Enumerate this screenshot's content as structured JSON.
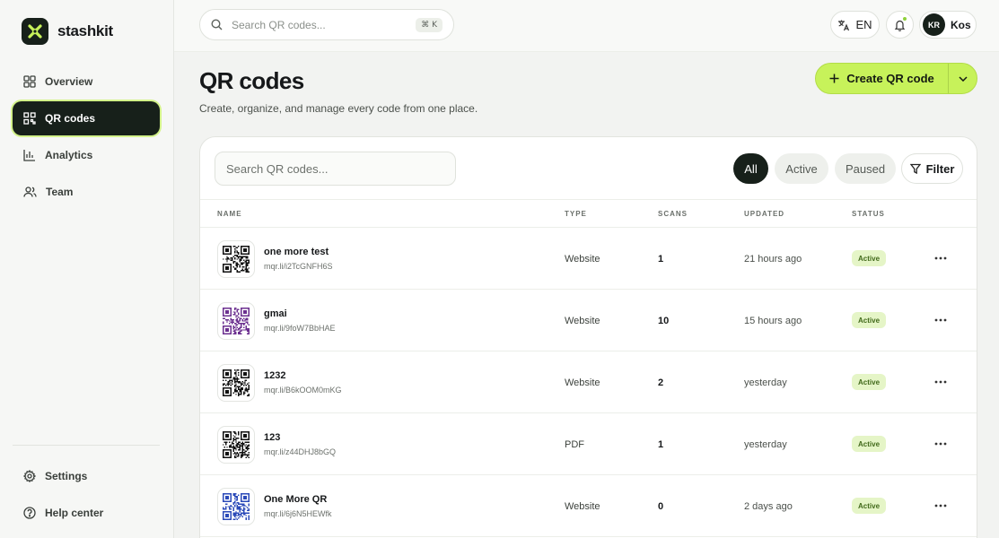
{
  "brand": {
    "name": "stashkit",
    "accent": "#c7f25a"
  },
  "sidebar": {
    "items": [
      {
        "label": "Overview",
        "icon": "grid-icon"
      },
      {
        "label": "QR codes",
        "icon": "qr-icon",
        "active": true
      },
      {
        "label": "Analytics",
        "icon": "bar-chart-icon"
      },
      {
        "label": "Team",
        "icon": "users-icon"
      }
    ],
    "bottom": [
      {
        "label": "Settings",
        "icon": "gear-icon"
      },
      {
        "label": "Help center",
        "icon": "help-icon"
      }
    ]
  },
  "topbar": {
    "search_placeholder": "Search QR codes...",
    "shortcut": "⌘ K",
    "language": "EN",
    "user_initials": "KR",
    "user_name": "Kos"
  },
  "header": {
    "title": "QR codes",
    "subtitle": "Create, organize, and manage every code from one place.",
    "create_label": "Create QR code"
  },
  "table": {
    "search_placeholder": "Search QR codes...",
    "filters": [
      "All",
      "Active",
      "Paused"
    ],
    "filter_button": "Filter",
    "columns": [
      "NAME",
      "TYPE",
      "SCANS",
      "UPDATED",
      "STATUS"
    ],
    "rows": [
      {
        "name": "one more test",
        "url": "mqr.li/i2TcGNFH6S",
        "type": "Website",
        "scans": "1",
        "updated": "21 hours ago",
        "status": "Active",
        "qr_color": "#111111"
      },
      {
        "name": "gmai",
        "url": "mqr.li/9foW7BbHAE",
        "type": "Website",
        "scans": "10",
        "updated": "15 hours ago",
        "status": "Active",
        "qr_color": "#6b2f8f"
      },
      {
        "name": "1232",
        "url": "mqr.li/B6kOOM0mKG",
        "type": "Website",
        "scans": "2",
        "updated": "yesterday",
        "status": "Active",
        "qr_color": "#111111"
      },
      {
        "name": "123",
        "url": "mqr.li/z44DHJ8bGQ",
        "type": "PDF",
        "scans": "1",
        "updated": "yesterday",
        "status": "Active",
        "qr_color": "#111111"
      },
      {
        "name": "One More QR",
        "url": "mqr.li/6j6N5HEWfk",
        "type": "Website",
        "scans": "0",
        "updated": "2 days ago",
        "status": "Active",
        "qr_color": "#2a49b8"
      }
    ]
  }
}
